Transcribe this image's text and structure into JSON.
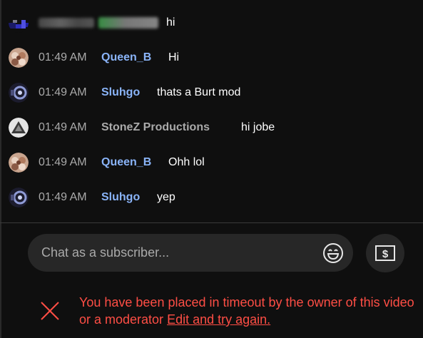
{
  "messages": [
    {
      "time": "",
      "author": "",
      "text": "hi",
      "redacted": true,
      "avatar": "blurred-avatar"
    },
    {
      "time": "01:49 AM",
      "author": "Queen_B",
      "text": "Hi",
      "author_style": "member",
      "avatar": "queen-b-avatar"
    },
    {
      "time": "01:49 AM",
      "author": "Sluhgo",
      "text": "thats a Burt mod",
      "author_style": "member",
      "avatar": "sluhgo-avatar"
    },
    {
      "time": "01:49 AM",
      "author": "StoneZ Productions",
      "text": "hi jobe",
      "author_style": "plain",
      "avatar": "stonez-avatar"
    },
    {
      "time": "01:49 AM",
      "author": "Queen_B",
      "text": "Ohh lol",
      "author_style": "member",
      "avatar": "queen-b-avatar"
    },
    {
      "time": "01:49 AM",
      "author": "Sluhgo",
      "text": "yep",
      "author_style": "member",
      "avatar": "sluhgo-avatar"
    }
  ],
  "input": {
    "placeholder": "Chat as a subscriber...",
    "emoji_icon": "smiley-face-icon",
    "superchat_icon": "dollar-bill-icon"
  },
  "timeout": {
    "message": "You have been placed in timeout by the owner of this video or a moderator",
    "link_label": "Edit and try again.",
    "close_icon": "close-x-icon"
  },
  "colors": {
    "background": "#0f0f0f",
    "timestamp": "#aaaaaa",
    "member_author": "#8ab4f8",
    "plain_author": "#aaaaaa",
    "message_text": "#ffffff",
    "input_bg": "#272727",
    "error": "#ff4e45"
  }
}
